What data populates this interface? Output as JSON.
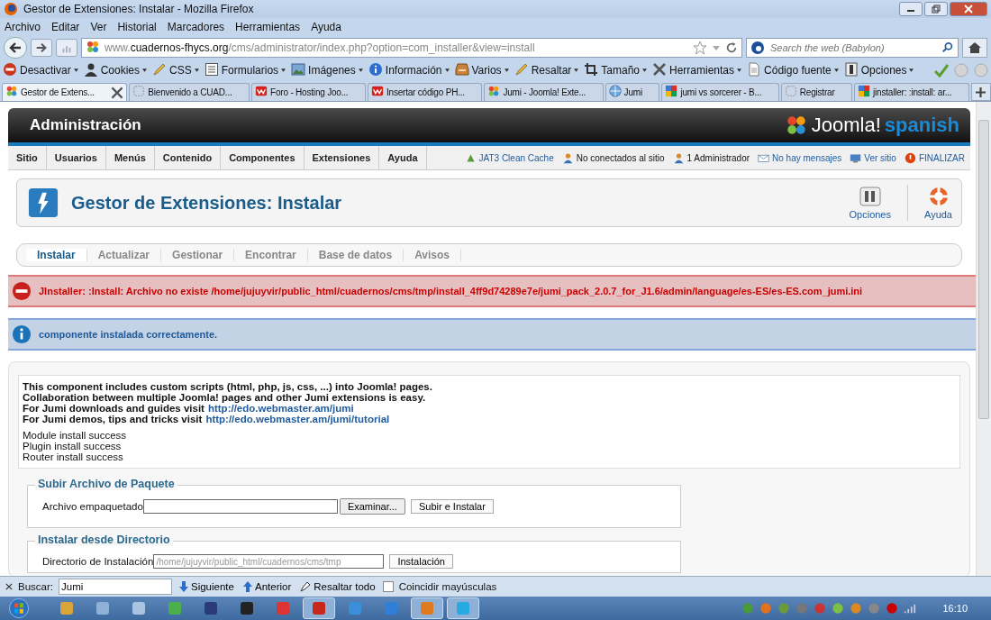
{
  "window": {
    "title": "Gestor de Extensiones: Instalar - Mozilla Firefox"
  },
  "menu_bar": [
    "Archivo",
    "Editar",
    "Ver",
    "Historial",
    "Marcadores",
    "Herramientas",
    "Ayuda"
  ],
  "nav": {
    "url_prefix": "www.",
    "url_host": "cuadernos-fhycs.org",
    "url_path": "/cms/administrator/index.php?option=com_installer&view=install",
    "search_placeholder": "Search the web (Babylon)"
  },
  "dev_toolbar": [
    {
      "label": "Desactivar"
    },
    {
      "label": "Cookies"
    },
    {
      "label": "CSS"
    },
    {
      "label": "Formularios"
    },
    {
      "label": "Imágenes"
    },
    {
      "label": "Información"
    },
    {
      "label": "Varios"
    },
    {
      "label": "Resaltar"
    },
    {
      "label": "Tamaño"
    },
    {
      "label": "Herramientas"
    },
    {
      "label": "Código fuente"
    },
    {
      "label": "Opciones"
    }
  ],
  "tabs": [
    {
      "title": "Gestor de Extens...",
      "selected": true
    },
    {
      "title": "Bienvenido a CUAD...",
      "selected": false
    },
    {
      "title": "Foro - Hosting Joo...",
      "selected": false
    },
    {
      "title": "Insertar código PH...",
      "selected": false
    },
    {
      "title": "Jumi - Joomla! Exte...",
      "selected": false
    },
    {
      "title": "Jumi",
      "selected": false
    },
    {
      "title": "jumi vs sorcerer - B...",
      "selected": false
    },
    {
      "title": "Registrar",
      "selected": false
    },
    {
      "title": "jinstaller: :install: ar...",
      "selected": false
    }
  ],
  "admin": {
    "title": "Administración",
    "logo_text": "Joomla!",
    "logo_sub": "spanish",
    "menu": [
      "Sitio",
      "Usuarios",
      "Menús",
      "Contenido",
      "Componentes",
      "Extensiones",
      "Ayuda"
    ],
    "status": [
      {
        "label": "JAT3 Clean Cache",
        "link": true
      },
      {
        "label": "No conectados al sitio",
        "link": false
      },
      {
        "label": "1 Administrador",
        "link": false
      },
      {
        "label": "No hay mensajes",
        "link": true
      },
      {
        "label": "Ver sitio",
        "link": true
      },
      {
        "label": "FINALIZAR",
        "link": true
      }
    ]
  },
  "page_title": "Gestor de Extensiones: Instalar",
  "toolbar_buttons": [
    "Opciones",
    "Ayuda"
  ],
  "submenu": [
    {
      "label": "Instalar",
      "selected": true
    },
    {
      "label": "Actualizar",
      "selected": false
    },
    {
      "label": "Gestionar",
      "selected": false
    },
    {
      "label": "Encontrar",
      "selected": false
    },
    {
      "label": "Base de datos",
      "selected": false
    },
    {
      "label": "Avisos",
      "selected": false
    }
  ],
  "messages": [
    {
      "kind": "error",
      "text": "JInstaller: :Install: Archivo no existe /home/jujuyvir/public_html/cuadernos/cms/tmp/install_4ff9d74289e7e/jumi_pack_2.0.7_for_J1.6/admin/language/es-ES/es-ES.com_jumi.ini"
    },
    {
      "kind": "info",
      "text": "componente instalada correctamente."
    }
  ],
  "description": [
    {
      "text": "This component includes custom scripts (html, php, js, css, ...) into Joomla! pages."
    },
    {
      "text": "Collaboration between multiple Joomla! pages and other Jumi extensions is easy."
    },
    {
      "text": "For Jumi downloads and guides visit",
      "link": "http://edo.webmaster.am/jumi"
    },
    {
      "text": "For Jumi demos, tips and tricks visit",
      "link": "http://edo.webmaster.am/jumi/tutorial"
    }
  ],
  "results": [
    "Module install success",
    "Plugin install success",
    "Router install success"
  ],
  "upload": {
    "legend": "Subir Archivo de Paquete",
    "label": "Archivo empaquetado",
    "browse": "Examinar...",
    "submit": "Subir e Instalar"
  },
  "directory": {
    "legend": "Instalar desde Directorio",
    "label": "Directorio de Instalación",
    "value": "/home/jujuyvir/public_html/cuadernos/cms/tmp",
    "submit": "Instalación"
  },
  "find_bar": {
    "label": "Buscar:",
    "value": "Jumi",
    "next": "Siguiente",
    "previous": "Anterior",
    "highlight": "Resaltar todo",
    "match_case": {
      "label": "Coincidir mayúsculas",
      "checked": false
    }
  },
  "taskbar": {
    "clock": "16:10"
  }
}
